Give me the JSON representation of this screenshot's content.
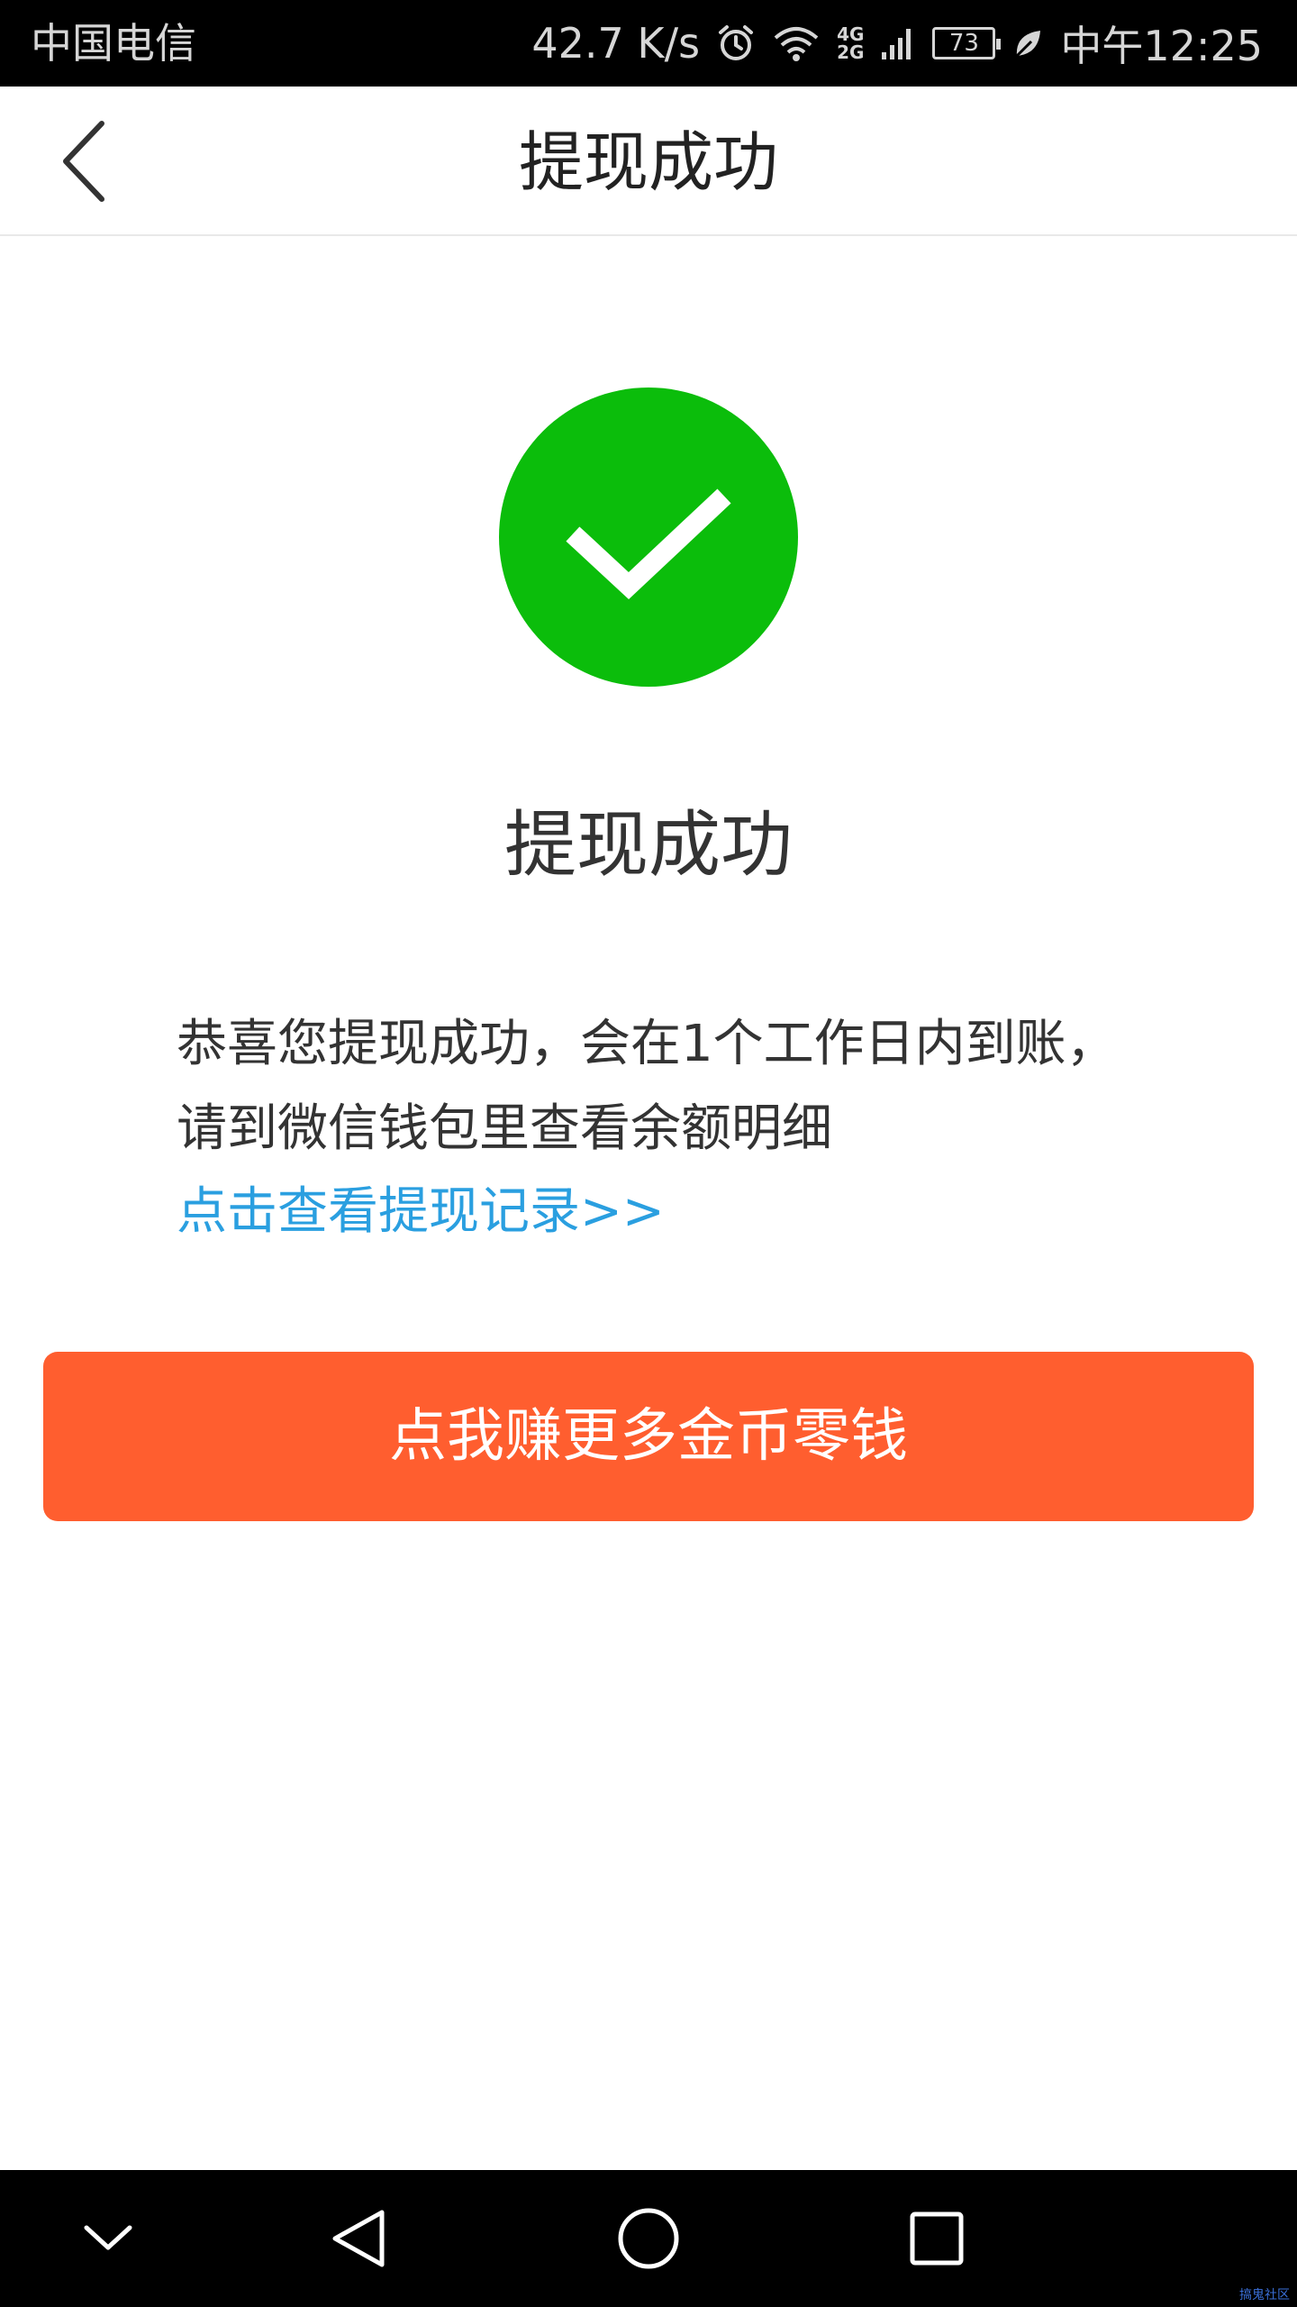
{
  "status_bar": {
    "carrier": "中国电信",
    "net_speed": "42.7 K/s",
    "network_top": "4G",
    "network_bottom": "2G",
    "battery": "73",
    "time": "中午12:25"
  },
  "header": {
    "title": "提现成功"
  },
  "main": {
    "success_title": "提现成功",
    "message": "恭喜您提现成功，会在1个工作日内到账， 请到微信钱包里查看余额明细",
    "record_link": "点击查看提现记录>>",
    "earn_button": "点我赚更多金币零钱"
  },
  "watermark": "搞鬼社区",
  "colors": {
    "success_green": "#0bbd0b",
    "button_orange": "#ff5e2f",
    "link_blue": "#2a9fe0"
  }
}
